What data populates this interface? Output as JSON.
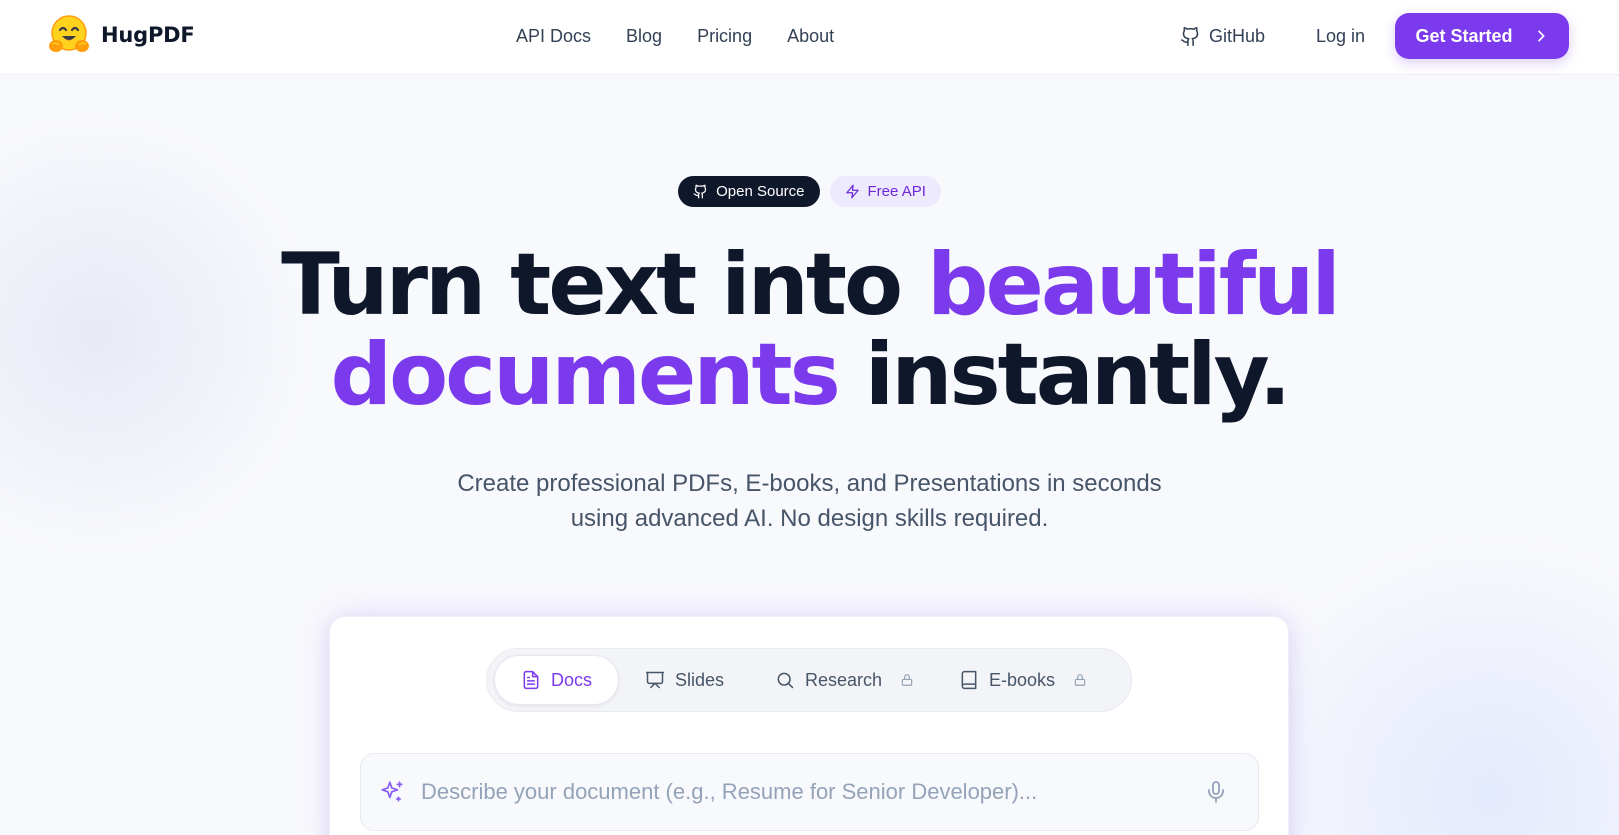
{
  "brand": {
    "name": "HugPDF",
    "logo_icon": "hugging-face-emoji-icon"
  },
  "nav": {
    "links": [
      "API Docs",
      "Blog",
      "Pricing",
      "About"
    ],
    "github_label": "GitHub",
    "login_label": "Log in",
    "cta_label": "Get Started"
  },
  "hero": {
    "badges": [
      {
        "label": "Open Source",
        "icon": "github-icon"
      },
      {
        "label": "Free API",
        "icon": "lightning-icon"
      }
    ],
    "headline_part1": "Turn text into ",
    "headline_accent1": "beautiful",
    "headline_accent2": "documents",
    "headline_part2": " instantly.",
    "subheadline_line1": "Create professional PDFs, E-books, and Presentations in seconds",
    "subheadline_line2": "using advanced AI. No design skills required."
  },
  "tabs": [
    {
      "label": "Docs",
      "icon": "document-icon",
      "active": true,
      "locked": false
    },
    {
      "label": "Slides",
      "icon": "presentation-icon",
      "active": false,
      "locked": false
    },
    {
      "label": "Research",
      "icon": "search-icon",
      "active": false,
      "locked": true
    },
    {
      "label": "E-books",
      "icon": "book-icon",
      "active": false,
      "locked": true
    }
  ],
  "prompt": {
    "placeholder": "Describe your document (e.g., Resume for Senior Developer)...",
    "value": ""
  },
  "colors": {
    "accent": "#7c3aed",
    "dark": "#0f172a",
    "text_muted": "#475569",
    "badge_light_bg": "#ede9fe"
  }
}
